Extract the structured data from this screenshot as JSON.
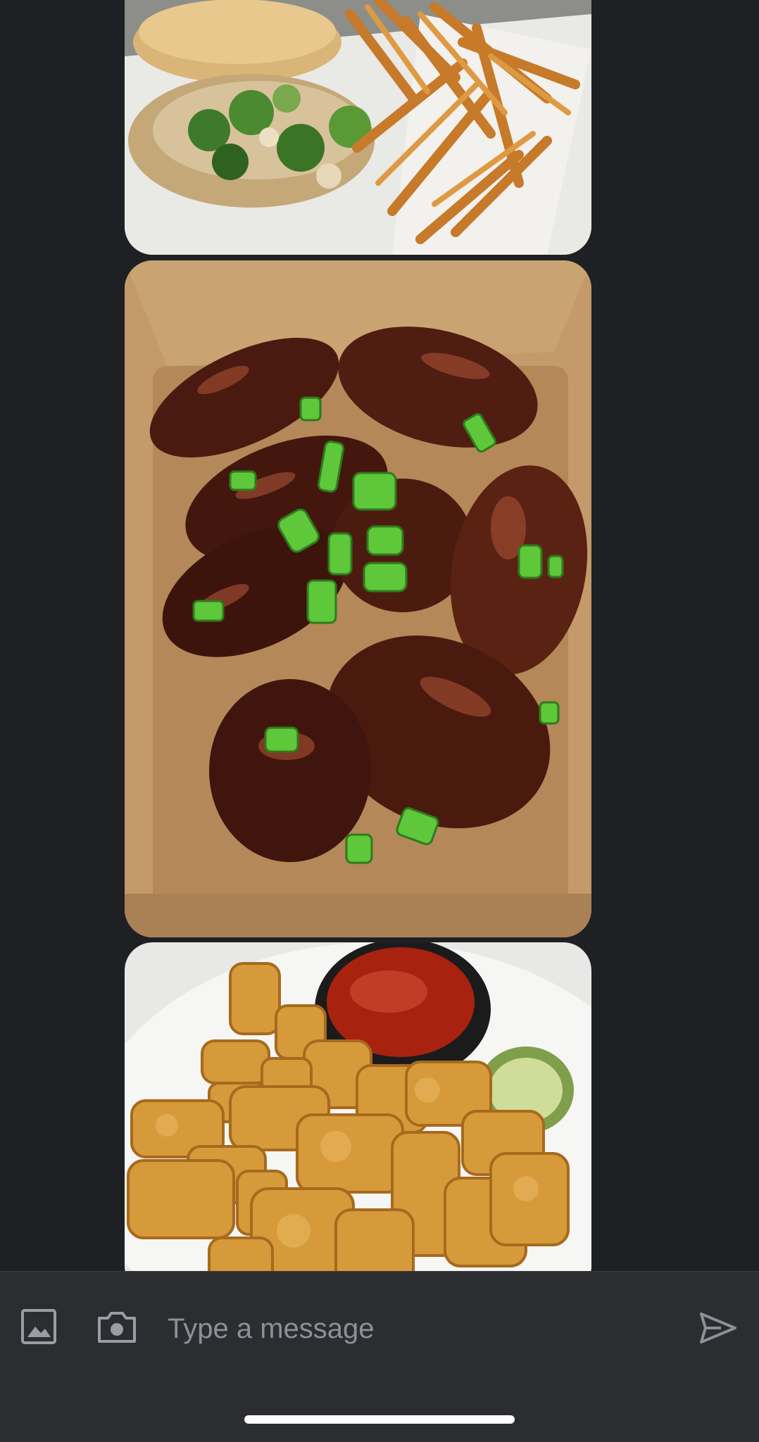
{
  "thread": {
    "images": [
      {
        "name": "photo-sandwich-fries",
        "subject": "sandwich-with-broccoli-and-fries"
      },
      {
        "name": "photo-glazed-wings",
        "subject": "glazed-wings-with-green-onion"
      },
      {
        "name": "photo-tater-tots",
        "subject": "tater-tots-with-ketchup-and-pickle"
      }
    ]
  },
  "composer": {
    "placeholder": "Type a message",
    "value": "",
    "icons": {
      "gallery": "image-icon",
      "camera": "camera-icon",
      "send": "send-icon"
    }
  },
  "colors": {
    "background": "#1e2024",
    "composer": "#2b2d31",
    "icon": "#9a9da3",
    "placeholder": "#8d9096"
  }
}
